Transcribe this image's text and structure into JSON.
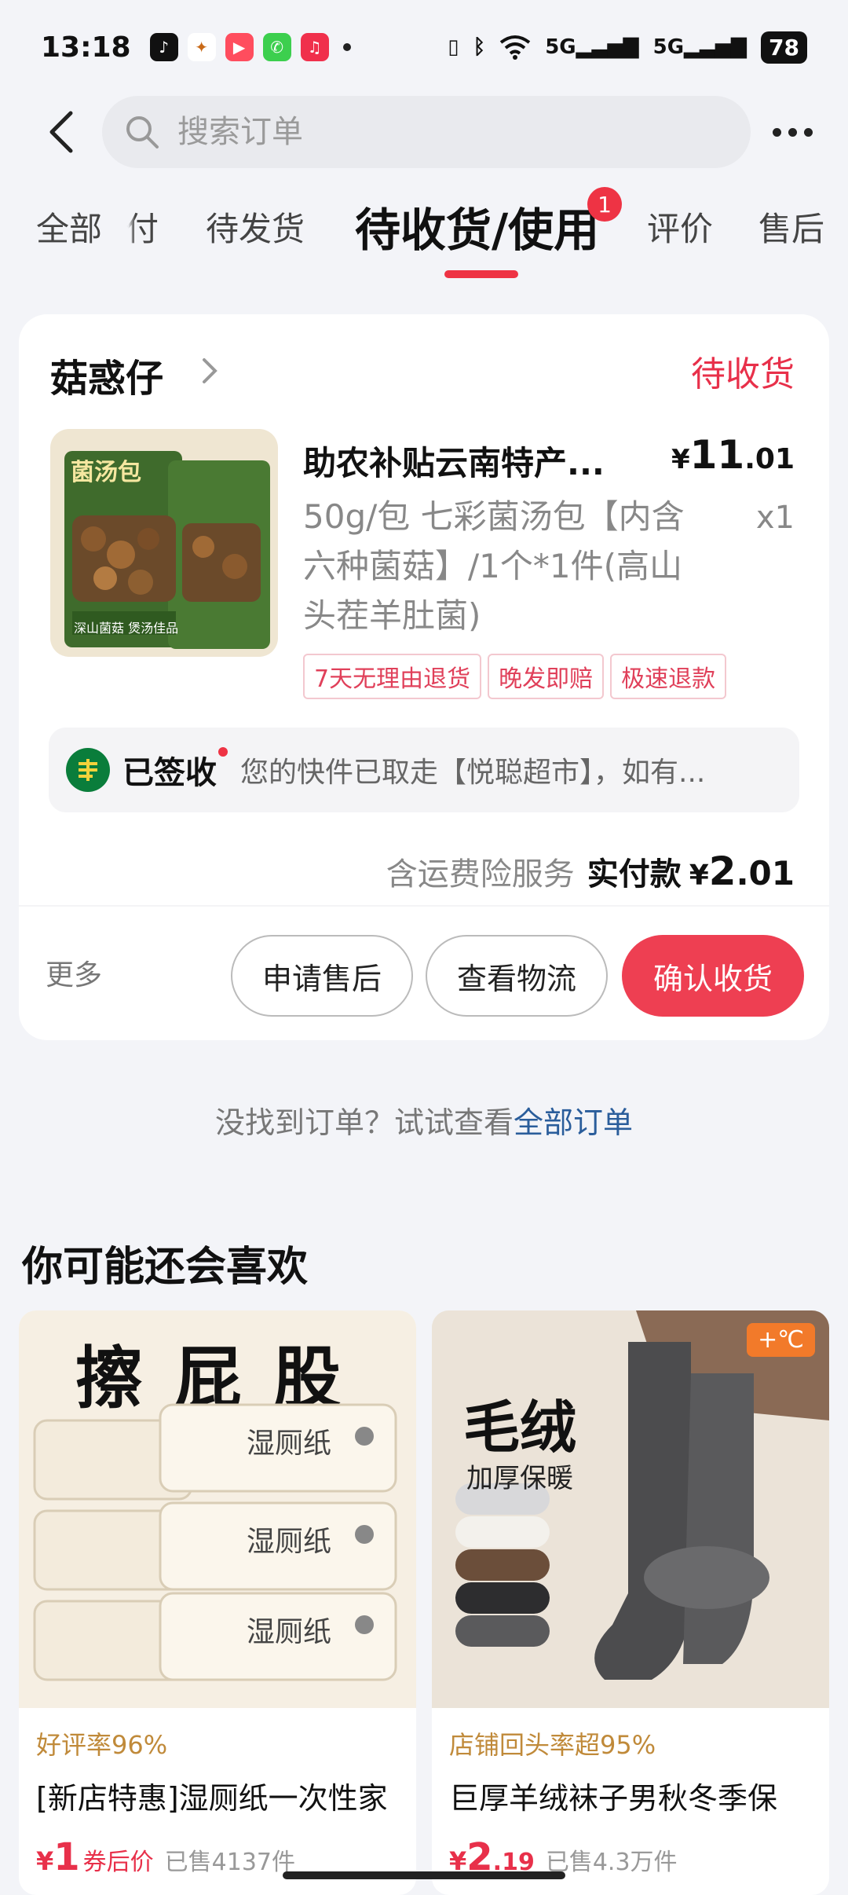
{
  "status_bar": {
    "time": "13:18",
    "network": "5G",
    "battery": "78"
  },
  "search": {
    "placeholder": "搜索订单"
  },
  "tabs": [
    {
      "label": "全部"
    },
    {
      "label": "付"
    },
    {
      "label": "待发货"
    },
    {
      "label": "待收货/使用",
      "active": true,
      "badge": "1"
    },
    {
      "label": "评价"
    },
    {
      "label": "售后"
    }
  ],
  "order": {
    "store_name": "菇惑仔",
    "status": "待收货",
    "image_label_top": "菌汤包",
    "image_label_bottom": "深山菌菇 煲汤佳品",
    "product_title": "助农补贴云南特产...",
    "price_symbol": "¥",
    "price_int": "11",
    "price_dec": ".01",
    "spec": "50g/包 七彩菌汤包【内含六种菌菇】/1个*1件(高山头茬羊肚菌)",
    "quantity": "x1",
    "tags": [
      "7天无理由退货",
      "晚发即赔",
      "极速退款"
    ],
    "logistics_status": "已签收",
    "logistics_message": "您的快件已取走【悦聪超市】，如有...",
    "insurance_label": "含运费险服务",
    "paid_label": "实付款",
    "paid_symbol": "¥",
    "paid_int": "2",
    "paid_dec": ".01",
    "more_label": "更多",
    "actions": {
      "after_sale": "申请售后",
      "view_logistics": "查看物流",
      "confirm_receipt": "确认收货"
    }
  },
  "hint": {
    "text": "没找到订单？试试查看",
    "link": "全部订单"
  },
  "recommend": {
    "title": "你可能还会喜欢",
    "items": [
      {
        "image_headline": "擦屁股",
        "image_pack_text": "湿厕纸",
        "stat": "好评率96%",
        "name": "[新店特惠]湿厕纸一次性家",
        "price_symbol": "¥",
        "price_int": "1",
        "price_dec": "",
        "price_note": "券后价",
        "sold": "已售4137件"
      },
      {
        "image_headline": "毛绒",
        "image_sub": "加厚保暖",
        "image_badge": "+℃",
        "stat": "店铺回头率超95%",
        "name": "巨厚羊绒袜子男秋冬季保",
        "price_symbol": "¥",
        "price_int": "2",
        "price_dec": ".19",
        "price_note": "",
        "sold": "已售4.3万件"
      }
    ]
  },
  "colors": {
    "accent": "#ee3344",
    "link": "#2a5d9b",
    "background": "#f3f4f8"
  }
}
